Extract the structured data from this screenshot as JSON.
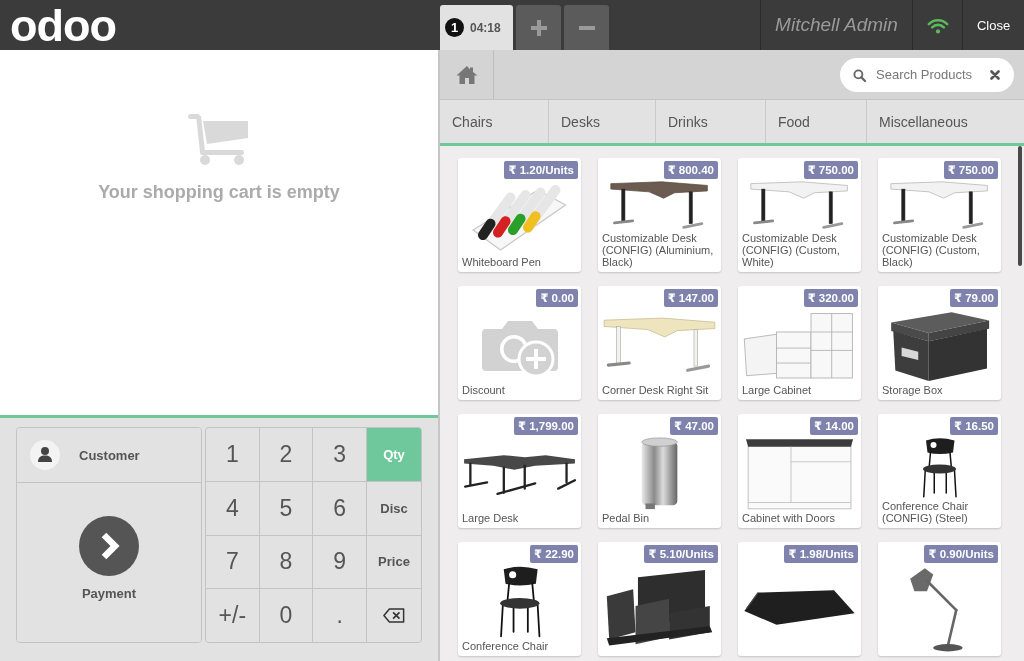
{
  "top_bar": {
    "logo": "odoo",
    "orders": [
      {
        "number": "1",
        "time": "04:18",
        "selected": true
      }
    ],
    "user": "Mitchell Admin",
    "close": "Close"
  },
  "cart": {
    "empty_message": "Your shopping cart is empty"
  },
  "control_pad": {
    "customer": "Customer",
    "payment": "Payment",
    "number_keys": [
      "1",
      "2",
      "3",
      "4",
      "5",
      "6",
      "7",
      "8",
      "9",
      "+/-",
      "0",
      "."
    ],
    "modes": [
      {
        "label": "Qty",
        "selected": true
      },
      {
        "label": "Disc",
        "selected": false
      },
      {
        "label": "Price",
        "selected": false
      }
    ]
  },
  "product_screen": {
    "search": {
      "placeholder": "Search Products"
    },
    "categories": [
      "Chairs",
      "Desks",
      "Drinks",
      "Food",
      "Miscellaneous"
    ],
    "products": [
      {
        "name": "Whiteboard Pen",
        "price": "₹ 1.20/Units",
        "kind": "photo"
      },
      {
        "name": "Customizable Desk (CONFIG) (Aluminium, Black)",
        "price": "₹ 800.40",
        "kind": "photo"
      },
      {
        "name": "Customizable Desk (CONFIG) (Custom, White)",
        "price": "₹ 750.00",
        "kind": "photo"
      },
      {
        "name": "Customizable Desk (CONFIG) (Custom, Black)",
        "price": "₹ 750.00",
        "kind": "photo"
      },
      {
        "name": "Discount",
        "price": "₹ 0.00",
        "kind": "placeholder"
      },
      {
        "name": "Corner Desk Right Sit",
        "price": "₹ 147.00",
        "kind": "photo"
      },
      {
        "name": "Large Cabinet",
        "price": "₹ 320.00",
        "kind": "photo"
      },
      {
        "name": "Storage Box",
        "price": "₹ 79.00",
        "kind": "photo"
      },
      {
        "name": "Large Desk",
        "price": "₹ 1,799.00",
        "kind": "photo"
      },
      {
        "name": "Pedal Bin",
        "price": "₹ 47.00",
        "kind": "photo"
      },
      {
        "name": "Cabinet with Doors",
        "price": "₹ 14.00",
        "kind": "photo"
      },
      {
        "name": "Conference Chair (CONFIG) (Steel)",
        "price": "₹ 16.50",
        "kind": "photo"
      },
      {
        "name": "Conference Chair",
        "price": "₹ 22.90",
        "kind": "photo"
      },
      {
        "price": "₹ 5.10/Units",
        "kind": "photo"
      },
      {
        "price": "₹ 1.98/Units",
        "kind": "photo"
      },
      {
        "price": "₹ 0.90/Units",
        "kind": "photo"
      }
    ]
  }
}
